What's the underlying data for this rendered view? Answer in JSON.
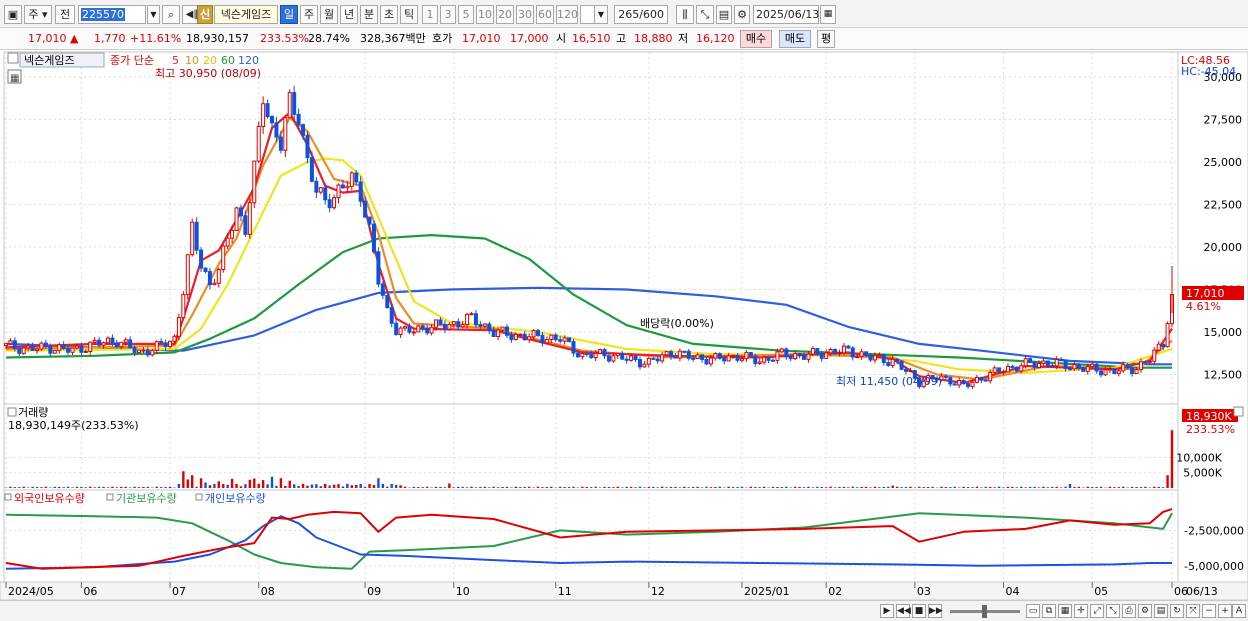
{
  "toolbar": {
    "market_sel": "주",
    "prev_label": "전",
    "code": "225570",
    "stock_badge": "신",
    "stock_name": "넥슨게임즈",
    "periods": [
      "일",
      "주",
      "월",
      "년",
      "분",
      "초",
      "틱"
    ],
    "intervals": [
      "1",
      "3",
      "5",
      "10",
      "20",
      "30",
      "60",
      "120"
    ],
    "count": "265",
    "count_total": "/600",
    "date": "2025/06/13"
  },
  "quote": {
    "price": "17,010",
    "change": "1,770",
    "change_pct": "+11.61%",
    "volume": "18,930,157",
    "volume_ratio": "233.53%",
    "turnover": "28.74%",
    "amount": "328,367백만",
    "hoga_label": "호가",
    "ask": "17,010",
    "bid": "17,000",
    "open_label": "시",
    "open": "16,510",
    "high_label": "고",
    "high": "18,880",
    "low_label": "저",
    "low": "16,120",
    "buy_btn": "매수",
    "sell_btn": "매도",
    "avg_btn": "평"
  },
  "price_panel": {
    "stock_name": "넥슨게임즈",
    "ma_label": "종가 단순",
    "ma_periods": [
      "5",
      "10",
      "20",
      "60",
      "120"
    ],
    "ma_colors": [
      "#e8202a",
      "#f08c1e",
      "#f0e41e",
      "#1e9a3c",
      "#2f5fe0"
    ],
    "high_annot": "최고 30,950 (08/09)",
    "low_annot": "최저 11,450 (04/09)",
    "dividend_annot": "배당락(0.00%)",
    "lc": "LC:48.56",
    "hc": "HC:-45.04",
    "last_price": "17,010",
    "last_pct": "4.61%",
    "y_ticks": [
      "30,000",
      "27,500",
      "25,000",
      "22,500",
      "20,000",
      "17,500",
      "15,000",
      "12,500"
    ]
  },
  "volume_panel": {
    "title": "거래량",
    "value": "18,930,149주(233.53%)",
    "last_vol": "18,930K",
    "last_pct": "233.53%",
    "y_ticks": [
      "10,000K",
      "5,000K"
    ]
  },
  "holding_panel": {
    "series": [
      {
        "name": "외국인보유수량",
        "color": "#e00000"
      },
      {
        "name": "기관보유수량",
        "color": "#2a9a4a"
      },
      {
        "name": "개인보유수량",
        "color": "#2050e0"
      }
    ],
    "y_ticks": [
      "-2,500,000",
      "-5,000,000"
    ]
  },
  "x_axis": {
    "labels": [
      "2024/05",
      "06",
      "07",
      "08",
      "09",
      "10",
      "11",
      "12",
      "2025/01",
      "02",
      "03",
      "04",
      "05",
      "06"
    ],
    "right_label": "06/13"
  },
  "colors": {
    "up": "#e00000",
    "down": "#1050e0",
    "grid": "#dddddd",
    "panel_border": "#c8c8c8"
  },
  "chart_data": {
    "type": "candlestick",
    "price_range": [
      11000,
      31000
    ],
    "ylim_volume": [
      0,
      19000
    ],
    "months": [
      "2024/05",
      "06",
      "07",
      "08",
      "09",
      "10",
      "11",
      "12",
      "2025/01",
      "02",
      "03",
      "04",
      "05",
      "06"
    ],
    "close_path": [
      [
        0,
        14200
      ],
      [
        5,
        14000
      ],
      [
        10,
        14100
      ],
      [
        15,
        13900
      ],
      [
        20,
        14300
      ],
      [
        25,
        14500
      ],
      [
        30,
        13800
      ],
      [
        35,
        14200
      ],
      [
        38,
        14600
      ],
      [
        40,
        17500
      ],
      [
        42,
        21000
      ],
      [
        44,
        19000
      ],
      [
        46,
        17800
      ],
      [
        48,
        18600
      ],
      [
        50,
        20500
      ],
      [
        52,
        22300
      ],
      [
        54,
        21000
      ],
      [
        56,
        24500
      ],
      [
        58,
        29000
      ],
      [
        60,
        27000
      ],
      [
        62,
        26000
      ],
      [
        64,
        28500
      ],
      [
        66,
        27800
      ],
      [
        68,
        25000
      ],
      [
        70,
        23200
      ],
      [
        72,
        22800
      ],
      [
        74,
        23000
      ],
      [
        76,
        23500
      ],
      [
        78,
        24000
      ],
      [
        80,
        23200
      ],
      [
        82,
        21000
      ],
      [
        84,
        18000
      ],
      [
        86,
        16200
      ],
      [
        88,
        15200
      ],
      [
        90,
        15000
      ],
      [
        95,
        15300
      ],
      [
        100,
        15400
      ],
      [
        105,
        15800
      ],
      [
        110,
        15000
      ],
      [
        115,
        14800
      ],
      [
        120,
        14700
      ],
      [
        125,
        14600
      ],
      [
        130,
        13600
      ],
      [
        135,
        13700
      ],
      [
        140,
        13400
      ],
      [
        145,
        13200
      ],
      [
        150,
        13800
      ],
      [
        155,
        13500
      ],
      [
        160,
        13400
      ],
      [
        165,
        13600
      ],
      [
        170,
        13300
      ],
      [
        175,
        13700
      ],
      [
        180,
        13600
      ],
      [
        185,
        13800
      ],
      [
        190,
        13900
      ],
      [
        195,
        13500
      ],
      [
        200,
        13300
      ],
      [
        203,
        12700
      ],
      [
        206,
        12100
      ],
      [
        210,
        12300
      ],
      [
        213,
        12200
      ],
      [
        216,
        11800
      ],
      [
        220,
        12300
      ],
      [
        225,
        12800
      ],
      [
        230,
        13100
      ],
      [
        235,
        13200
      ],
      [
        240,
        13000
      ],
      [
        245,
        12800
      ],
      [
        250,
        12700
      ],
      [
        255,
        12900
      ],
      [
        258,
        13400
      ],
      [
        261,
        14400
      ],
      [
        262,
        15800
      ],
      [
        263,
        17010
      ]
    ],
    "ma5_path": [
      [
        0,
        14100
      ],
      [
        20,
        14300
      ],
      [
        38,
        14300
      ],
      [
        40,
        15800
      ],
      [
        44,
        19200
      ],
      [
        48,
        19800
      ],
      [
        52,
        21600
      ],
      [
        56,
        23500
      ],
      [
        60,
        27000
      ],
      [
        64,
        27900
      ],
      [
        68,
        26000
      ],
      [
        72,
        23600
      ],
      [
        76,
        23200
      ],
      [
        80,
        23300
      ],
      [
        84,
        19000
      ],
      [
        88,
        15800
      ],
      [
        92,
        15200
      ],
      [
        110,
        15100
      ],
      [
        130,
        13800
      ],
      [
        150,
        13600
      ],
      [
        170,
        13500
      ],
      [
        190,
        13800
      ],
      [
        200,
        13400
      ],
      [
        206,
        12400
      ],
      [
        216,
        12000
      ],
      [
        230,
        13000
      ],
      [
        250,
        12800
      ],
      [
        258,
        13300
      ],
      [
        262,
        14800
      ],
      [
        263,
        15200
      ]
    ],
    "ma10_path": [
      [
        0,
        14000
      ],
      [
        38,
        14200
      ],
      [
        42,
        16000
      ],
      [
        48,
        19000
      ],
      [
        52,
        20500
      ],
      [
        58,
        24800
      ],
      [
        64,
        27600
      ],
      [
        68,
        26800
      ],
      [
        74,
        24000
      ],
      [
        80,
        23600
      ],
      [
        84,
        20800
      ],
      [
        88,
        17000
      ],
      [
        92,
        15500
      ],
      [
        110,
        15200
      ],
      [
        130,
        13900
      ],
      [
        150,
        13500
      ],
      [
        180,
        13700
      ],
      [
        200,
        13500
      ],
      [
        210,
        12500
      ],
      [
        220,
        12200
      ],
      [
        235,
        13000
      ],
      [
        255,
        12800
      ],
      [
        263,
        14500
      ]
    ],
    "ma20_path": [
      [
        0,
        13900
      ],
      [
        38,
        14000
      ],
      [
        44,
        15200
      ],
      [
        50,
        17800
      ],
      [
        56,
        21000
      ],
      [
        62,
        24200
      ],
      [
        68,
        25000
      ],
      [
        72,
        25200
      ],
      [
        76,
        25100
      ],
      [
        80,
        24200
      ],
      [
        86,
        20500
      ],
      [
        92,
        16800
      ],
      [
        100,
        15600
      ],
      [
        120,
        15000
      ],
      [
        140,
        14000
      ],
      [
        160,
        13700
      ],
      [
        190,
        13600
      ],
      [
        205,
        13300
      ],
      [
        215,
        12800
      ],
      [
        230,
        12600
      ],
      [
        250,
        12900
      ],
      [
        263,
        14000
      ]
    ],
    "ma60_path": [
      [
        0,
        13500
      ],
      [
        20,
        13600
      ],
      [
        38,
        13800
      ],
      [
        46,
        14600
      ],
      [
        56,
        15800
      ],
      [
        66,
        17800
      ],
      [
        76,
        19700
      ],
      [
        84,
        20500
      ],
      [
        96,
        20700
      ],
      [
        108,
        20500
      ],
      [
        118,
        19300
      ],
      [
        128,
        17200
      ],
      [
        140,
        15400
      ],
      [
        155,
        14300
      ],
      [
        175,
        13900
      ],
      [
        195,
        13700
      ],
      [
        215,
        13500
      ],
      [
        235,
        13200
      ],
      [
        255,
        12900
      ],
      [
        263,
        12900
      ]
    ],
    "ma120_path": [
      [
        0,
        14300
      ],
      [
        20,
        14100
      ],
      [
        40,
        13900
      ],
      [
        56,
        14800
      ],
      [
        70,
        16300
      ],
      [
        84,
        17300
      ],
      [
        100,
        17500
      ],
      [
        120,
        17600
      ],
      [
        140,
        17500
      ],
      [
        160,
        17100
      ],
      [
        176,
        16600
      ],
      [
        190,
        15300
      ],
      [
        206,
        14300
      ],
      [
        220,
        13900
      ],
      [
        240,
        13300
      ],
      [
        258,
        13100
      ],
      [
        263,
        13100
      ]
    ],
    "volume_bars": [
      {
        "i": 40,
        "v": 5500,
        "up": true
      },
      {
        "i": 41,
        "v": 2800,
        "up": true
      },
      {
        "i": 42,
        "v": 4200,
        "up": true
      },
      {
        "i": 44,
        "v": 3200,
        "up": true
      },
      {
        "i": 45,
        "v": 1800,
        "up": false
      },
      {
        "i": 48,
        "v": 2200,
        "up": true
      },
      {
        "i": 51,
        "v": 3000,
        "up": true
      },
      {
        "i": 55,
        "v": 2700,
        "up": true
      },
      {
        "i": 56,
        "v": 3100,
        "up": true
      },
      {
        "i": 58,
        "v": 2600,
        "up": true
      },
      {
        "i": 60,
        "v": 3700,
        "up": false
      },
      {
        "i": 62,
        "v": 3200,
        "up": true
      },
      {
        "i": 64,
        "v": 2400,
        "up": true
      },
      {
        "i": 84,
        "v": 3200,
        "up": false
      },
      {
        "i": 100,
        "v": 1500,
        "up": true
      },
      {
        "i": 200,
        "v": 800,
        "up": true
      },
      {
        "i": 240,
        "v": 1300,
        "up": false
      },
      {
        "i": 262,
        "v": 4200,
        "up": true
      },
      {
        "i": 263,
        "v": 18930,
        "up": true
      }
    ],
    "foreign_path": [
      [
        0,
        -4800000
      ],
      [
        8,
        -5200000
      ],
      [
        18,
        -5100000
      ],
      [
        30,
        -5000000
      ],
      [
        40,
        -4300000
      ],
      [
        48,
        -3800000
      ],
      [
        56,
        -3400000
      ],
      [
        60,
        -1600000
      ],
      [
        64,
        -1700000
      ],
      [
        68,
        -1400000
      ],
      [
        74,
        -1200000
      ],
      [
        80,
        -1300000
      ],
      [
        84,
        -2600000
      ],
      [
        88,
        -1600000
      ],
      [
        96,
        -1400000
      ],
      [
        110,
        -1700000
      ],
      [
        125,
        -3000000
      ],
      [
        140,
        -2600000
      ],
      [
        160,
        -2500000
      ],
      [
        180,
        -2400000
      ],
      [
        200,
        -2200000
      ],
      [
        206,
        -3300000
      ],
      [
        216,
        -2600000
      ],
      [
        230,
        -2400000
      ],
      [
        240,
        -1800000
      ],
      [
        250,
        -2100000
      ],
      [
        258,
        -2000000
      ],
      [
        261,
        -1200000
      ],
      [
        263,
        -1000000
      ]
    ],
    "inst_path": [
      [
        0,
        -1400000
      ],
      [
        20,
        -1500000
      ],
      [
        34,
        -1600000
      ],
      [
        42,
        -2000000
      ],
      [
        50,
        -3200000
      ],
      [
        56,
        -4200000
      ],
      [
        62,
        -4800000
      ],
      [
        70,
        -5100000
      ],
      [
        78,
        -5200000
      ],
      [
        82,
        -4000000
      ],
      [
        90,
        -3900000
      ],
      [
        110,
        -3600000
      ],
      [
        125,
        -2500000
      ],
      [
        140,
        -2800000
      ],
      [
        160,
        -2600000
      ],
      [
        180,
        -2300000
      ],
      [
        206,
        -1300000
      ],
      [
        230,
        -1600000
      ],
      [
        250,
        -2000000
      ],
      [
        261,
        -2400000
      ],
      [
        263,
        -1300000
      ]
    ],
    "indiv_path": [
      [
        0,
        -5200000
      ],
      [
        20,
        -5100000
      ],
      [
        38,
        -4700000
      ],
      [
        46,
        -4200000
      ],
      [
        54,
        -3200000
      ],
      [
        58,
        -2200000
      ],
      [
        62,
        -1500000
      ],
      [
        66,
        -2000000
      ],
      [
        70,
        -3000000
      ],
      [
        80,
        -4200000
      ],
      [
        90,
        -4300000
      ],
      [
        110,
        -4600000
      ],
      [
        125,
        -4800000
      ],
      [
        140,
        -4700000
      ],
      [
        170,
        -4800000
      ],
      [
        200,
        -4900000
      ],
      [
        220,
        -5000000
      ],
      [
        250,
        -4900000
      ],
      [
        258,
        -4800000
      ],
      [
        263,
        -4800000
      ]
    ]
  }
}
